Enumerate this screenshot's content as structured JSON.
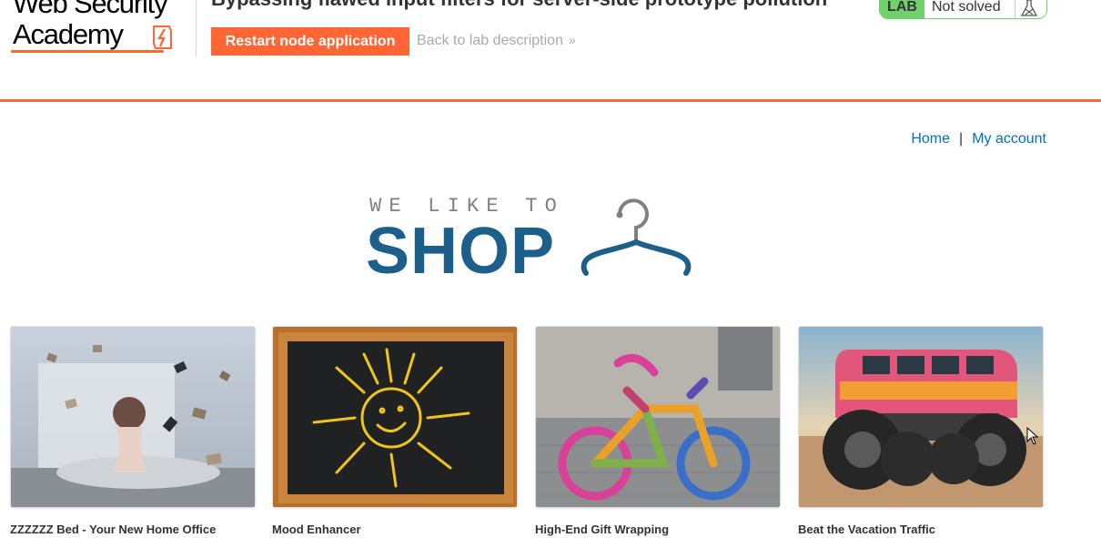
{
  "logo": {
    "line1": "Web Security",
    "line2": "Academy"
  },
  "lab": {
    "title": "Bypassing flawed input filters for server-side prototype pollution",
    "restart_label": "Restart node application",
    "back_label": "Back to lab description",
    "status_tag": "LAB",
    "status_text": "Not solved",
    "icon": "flask-icon"
  },
  "nav": {
    "home": "Home",
    "separator": "|",
    "account": "My account"
  },
  "banner": {
    "tagline": "WE LIKE TO",
    "brand": "SHOP",
    "icon": "hanger-icon"
  },
  "products": [
    {
      "name": "ZZZZZZ Bed - Your New Home Office"
    },
    {
      "name": "Mood Enhancer"
    },
    {
      "name": "High-End Gift Wrapping"
    },
    {
      "name": "Beat the Vacation Traffic"
    }
  ],
  "colors": {
    "accent": "#ff6633",
    "brand": "#1b5f8a",
    "link": "#0071bc",
    "solved_green": "#70d16d"
  }
}
